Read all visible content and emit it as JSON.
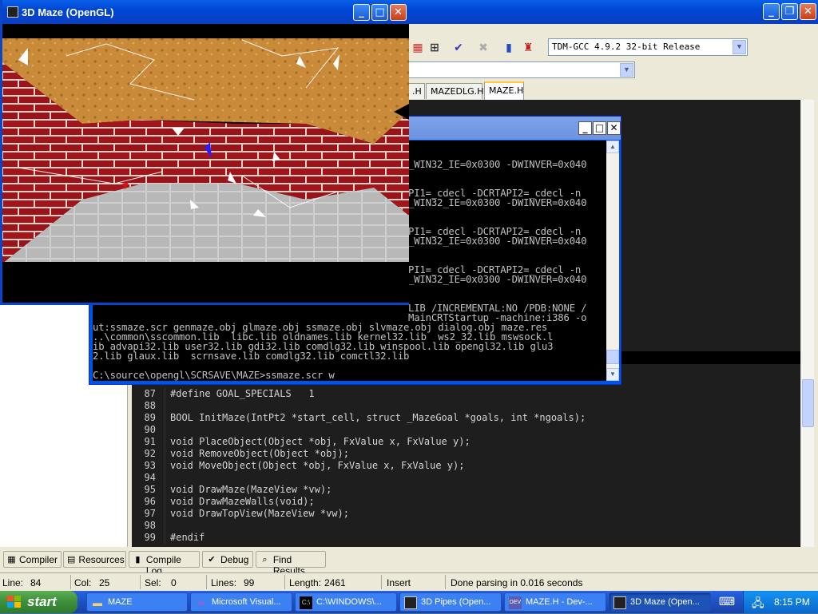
{
  "ide": {
    "compiler_select": "TDM-GCC 4.9.2 32-bit Release",
    "tabs": [
      ".H",
      "MAZEDLG.H",
      "MAZE.H"
    ],
    "code": [
      {
        "n": "87",
        "text": "#define GOAL_SPECIALS   1"
      },
      {
        "n": "88",
        "text": ""
      },
      {
        "n": "89",
        "text": "BOOL InitMaze(IntPt2 *start_cell, struct _MazeGoal *goals, int *ngoals);"
      },
      {
        "n": "90",
        "text": ""
      },
      {
        "n": "91",
        "text": "void PlaceObject(Object *obj, FxValue x, FxValue y);"
      },
      {
        "n": "92",
        "text": "void RemoveObject(Object *obj);"
      },
      {
        "n": "93",
        "text": "void MoveObject(Object *obj, FxValue x, FxValue y);"
      },
      {
        "n": "94",
        "text": ""
      },
      {
        "n": "95",
        "text": "void DrawMaze(MazeView *vw);"
      },
      {
        "n": "96",
        "text": "void DrawMazeWalls(void);"
      },
      {
        "n": "97",
        "text": "void DrawTopView(MazeView *vw);"
      },
      {
        "n": "98",
        "text": ""
      },
      {
        "n": "99",
        "text": "#endif"
      }
    ],
    "bottom_tabs": [
      "Compiler",
      "Resources",
      "Compile Log",
      "Debug",
      "Find Results"
    ],
    "status": {
      "line_label": "Line:",
      "line_value": "84",
      "col_label": "Col:",
      "col_value": "25",
      "sel_label": "Sel:",
      "sel_value": "0",
      "lines_label": "Lines:",
      "lines_value": "99",
      "length_label": "Length:",
      "length_value": "2461",
      "mode": "Insert",
      "message": "Done parsing in 0.016 seconds"
    }
  },
  "console": {
    "lines": [
      "                                                            ",
      "                                                            ",
      "_WIN32_IE=0x0300 -DWINVER=0x040",
      "",
      "",
      "PI1=_cdecl -DCRTAPI2=_cdecl -n",
      "_WIN32_IE=0x0300 -DWINVER=0x040",
      "",
      "",
      "PI1=_cdecl -DCRTAPI2=_cdecl -n",
      "_WIN32_IE=0x0300 -DWINVER=0x040",
      "",
      "",
      "PI1=_cdecl -DCRTAPI2=_cdecl -n",
      "_WIN32_IE=0x0300 -DWINVER=0x040",
      "",
      "",
      "LIB /INCREMENTAL:NO /PDB:NONE /",
      "MainCRTStartup -machine:i386 -o",
      "ut:ssmaze.scr genmaze.obj glmaze.obj ssmaze.obj slvmaze.obj dialog.obj maze.res",
      "..\\common\\sscommon.lib  libc.lib oldnames.lib kernel32.lib  ws2_32.lib mswsock.l",
      "ib advapi32.lib user32.lib gdi32.lib comdlg32.lib winspool.lib opengl32.lib glu3",
      "2.lib glaux.lib  scrnsave.lib comdlg32.lib comctl32.lib",
      "",
      "C:\\source\\opengl\\SCRSAVE\\MAZE>ssmaze.scr w",
      "",
      "C:\\source\\opengl\\SCRSAVE\\MAZE>"
    ]
  },
  "maze_window": {
    "title": "3D Maze (OpenGL)"
  },
  "taskbar": {
    "start": "start",
    "items": [
      {
        "label": "MAZE",
        "icon": "folder-icon"
      },
      {
        "label": "Microsoft Visual...",
        "icon": "visual-studio-icon"
      },
      {
        "label": "C:\\WINDOWS\\...",
        "icon": "console-icon"
      },
      {
        "label": "3D Pipes (Open...",
        "icon": "opengl-app-icon"
      },
      {
        "label": "MAZE.H - Dev-...",
        "icon": "devcpp-icon"
      },
      {
        "label": "3D Maze (Open...",
        "icon": "opengl-app-icon"
      }
    ],
    "clock": "8:15 PM"
  }
}
